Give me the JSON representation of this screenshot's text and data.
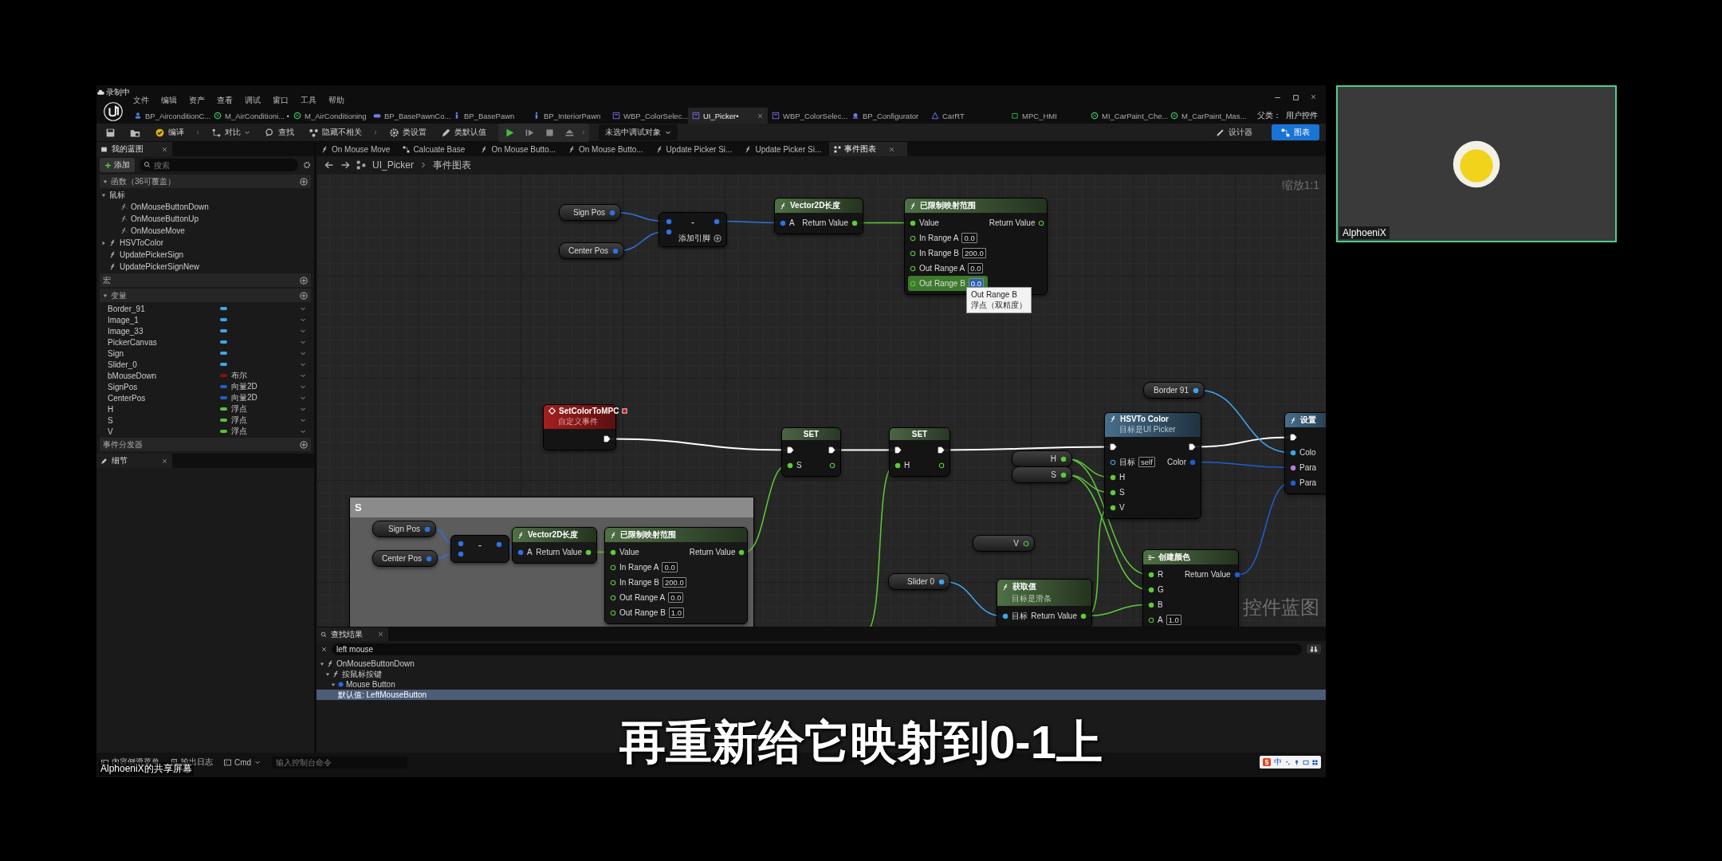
{
  "recording_indicator": "录制中",
  "menu": [
    "文件",
    "编辑",
    "资产",
    "查看",
    "调试",
    "窗口",
    "工具",
    "帮助"
  ],
  "document_tabs": [
    {
      "label": "BP_AirconditionC...",
      "kind": "blueprint",
      "selected": false
    },
    {
      "label": "M_AirConditioni... •",
      "kind": "material",
      "selected": false
    },
    {
      "label": "M_AirConditioning",
      "kind": "material",
      "selected": false
    },
    {
      "label": "BP_BasePawnCo...",
      "kind": "pawn",
      "selected": false
    },
    {
      "label": "BP_BasePawn",
      "kind": "actor",
      "selected": false
    },
    {
      "label": "BP_InteriorPawn",
      "kind": "actor",
      "selected": false
    },
    {
      "label": "WBP_ColorSelec...",
      "kind": "widget",
      "selected": false
    },
    {
      "label": "UI_Picker•",
      "kind": "widget",
      "selected": true
    },
    {
      "label": "WBP_ColorSelec...",
      "kind": "widget",
      "selected": false
    },
    {
      "label": "BP_Configurator",
      "kind": "component",
      "selected": false
    },
    {
      "label": "CarRT",
      "kind": "render_target",
      "selected": false
    },
    {
      "label": "MPC_HMI",
      "kind": "collection",
      "selected": false
    },
    {
      "label": "MI_CarPaint_Che...",
      "kind": "material",
      "selected": false
    },
    {
      "label": "M_CarPaint_Mas...",
      "kind": "material",
      "selected": false
    }
  ],
  "parent_class": {
    "label": "父类：",
    "value": "用户控件"
  },
  "toolbar": [
    {
      "kind": "save"
    },
    {
      "kind": "browse"
    },
    {
      "kind": "compile",
      "label": "编译",
      "more": true
    },
    {
      "kind": "diff",
      "label": "对比",
      "caret": true
    },
    {
      "kind": "find",
      "label": "查找"
    },
    {
      "kind": "hide",
      "label": "隐藏不相关",
      "more": true
    },
    {
      "kind": "settings",
      "label": "类设置"
    },
    {
      "kind": "defaults",
      "label": "类默认值"
    },
    {
      "kind": "play"
    },
    {
      "kind": "step"
    },
    {
      "kind": "stop"
    },
    {
      "kind": "eject",
      "more": true
    }
  ],
  "debug_dropdown": {
    "value": "未选中调试对象"
  },
  "modes": [
    {
      "label": "设计器",
      "selected": false
    },
    {
      "label": "图表",
      "selected": true
    }
  ],
  "my_blueprint": {
    "tab": "我的蓝图",
    "add_button": "添加",
    "search": {
      "placeholder": "搜索"
    },
    "functions": {
      "header": "函数（36可覆盖）",
      "expanded": true,
      "items": [
        {
          "kind": "category",
          "label": "鼠标",
          "expanded": true,
          "children": [
            {
              "kind": "override",
              "label": "OnMouseButtonDown"
            },
            {
              "kind": "override",
              "label": "OnMouseButtonUp"
            },
            {
              "kind": "override",
              "label": "OnMouseMove"
            }
          ]
        },
        {
          "kind": "function",
          "label": "HSVToColor",
          "expanded": false
        },
        {
          "kind": "function",
          "label": "UpdatePickerSign"
        },
        {
          "kind": "function",
          "label": "UpdatePickerSignNew"
        }
      ]
    },
    "macros": {
      "header": "宏"
    },
    "variables": {
      "header": "变量",
      "expanded": true,
      "items": [
        {
          "name": "Border_91",
          "color": "#3fa7e6"
        },
        {
          "name": "Image_1",
          "color": "#3fa7e6"
        },
        {
          "name": "Image_33",
          "color": "#3fa7e6"
        },
        {
          "name": "PickerCanvas",
          "color": "#3fa7e6"
        },
        {
          "name": "Sign",
          "color": "#3fa7e6"
        },
        {
          "name": "Slider_0",
          "color": "#3fa7e6"
        },
        {
          "name": "bMouseDown",
          "type": "布尔",
          "color": "#8a0f12"
        },
        {
          "name": "SignPos",
          "type": "向量2D",
          "color": "#1f5fc8"
        },
        {
          "name": "CenterPos",
          "type": "向量2D",
          "color": "#1f5fc8"
        },
        {
          "name": "H",
          "type": "浮点",
          "color": "#56c23a"
        },
        {
          "name": "S",
          "type": "浮点",
          "color": "#56c23a"
        },
        {
          "name": "V",
          "type": "浮点",
          "color": "#56c23a"
        }
      ]
    },
    "event_dispatchers": {
      "header": "事件分发器"
    },
    "details_tab": "细节"
  },
  "graph_tabs": [
    {
      "kind": "function",
      "label": "On Mouse Move",
      "selected": false
    },
    {
      "kind": "macro",
      "label": "Calcuate Base",
      "selected": false
    },
    {
      "kind": "function",
      "label": "On Mouse Butto...",
      "selected": false
    },
    {
      "kind": "function",
      "label": "On Mouse Butto...",
      "selected": false
    },
    {
      "kind": "function",
      "label": "Update Picker Si...",
      "selected": false
    },
    {
      "kind": "function",
      "label": "Update Picker Si...",
      "selected": false
    },
    {
      "kind": "graph",
      "label": "事件图表",
      "selected": true
    }
  ],
  "breadcrumb": [
    "UI_Picker",
    "事件图表"
  ],
  "graph": {
    "zoom_label": "缩放1:1",
    "type_label": "控件蓝图",
    "nodes": [
      {
        "kind": "getter",
        "label": "Sign Pos",
        "pin": {
          "kind": "vector2d",
          "connected": true
        }
      },
      {
        "kind": "getter",
        "label": "Center Pos",
        "pin": {
          "kind": "vector2d",
          "connected": true
        }
      },
      {
        "kind": "math",
        "symbol": "-",
        "add_pin": "添加引脚",
        "inputs": [
          {
            "kind": "vector2d",
            "connected": true
          },
          {
            "kind": "vector2d",
            "connected": true
          }
        ],
        "outputs": [
          {
            "kind": "vector2d",
            "connected": true
          }
        ]
      },
      {
        "kind": "pure_function",
        "title": "Vector2D长度",
        "inputs": [
          {
            "label": "A",
            "kind": "vector2d",
            "connected": true
          }
        ],
        "outputs": [
          {
            "label": "Return Value",
            "kind": "float",
            "connected": true
          }
        ]
      },
      {
        "kind": "pure_function",
        "title": "已限制映射范围",
        "inputs": [
          {
            "label": "Value",
            "kind": "float",
            "connected": true,
            "highlighted": false
          },
          {
            "label": "In Range A",
            "kind": "float",
            "connected": false,
            "value": "0.0",
            "highlighted": false
          },
          {
            "label": "In Range B",
            "kind": "float",
            "connected": false,
            "value": "200.0",
            "highlighted": false
          },
          {
            "label": "Out Range A",
            "kind": "float",
            "connected": false,
            "value": "0.0",
            "highlighted": false
          },
          {
            "label": "Out Range B",
            "kind": "float",
            "connected": false,
            "value": "0.0",
            "highlighted": true
          }
        ],
        "outputs": [
          {
            "label": "Return Value",
            "kind": "float",
            "connected": false
          }
        ]
      },
      {
        "kind": "getter",
        "label": "Border 91",
        "pin": {
          "kind": "object",
          "connected": true
        }
      },
      {
        "kind": "event",
        "title": "SetColorToMPC",
        "subtitle": "自定义事件",
        "exec_out": true
      },
      {
        "kind": "set",
        "title": "SET",
        "exec_in": true,
        "exec_out": true,
        "inputs": [
          {
            "label": "S",
            "kind": "float",
            "connected": true
          }
        ],
        "outputs": [
          {
            "kind": "float",
            "connected": false
          }
        ]
      },
      {
        "kind": "set",
        "title": "SET",
        "exec_in": true,
        "exec_out": true,
        "inputs": [
          {
            "label": "H",
            "kind": "float",
            "connected": true
          }
        ],
        "outputs": [
          {
            "kind": "float",
            "connected": false
          }
        ]
      },
      {
        "kind": "getter",
        "label": "H",
        "pin": {
          "kind": "float",
          "connected": true
        }
      },
      {
        "kind": "getter",
        "label": "S",
        "pin": {
          "kind": "float",
          "connected": true
        }
      },
      {
        "kind": "function",
        "title": "HSVTo Color",
        "subtitle": "目标是UI Picker",
        "exec_in": true,
        "exec_out": true,
        "inputs": [
          {
            "label": "目标",
            "kind": "object",
            "connected": false,
            "value": "self"
          },
          {
            "label": "H",
            "kind": "float",
            "connected": true
          },
          {
            "label": "S",
            "kind": "float",
            "connected": true
          },
          {
            "label": "V",
            "kind": "float",
            "connected": true
          }
        ],
        "outputs": [
          {
            "label": "Color",
            "kind": "struct",
            "connected": true
          }
        ]
      },
      {
        "kind": "function",
        "title": "设置",
        "exec_in": true,
        "inputs": [
          {
            "label": "Colo",
            "kind": "object",
            "connected": true
          },
          {
            "label": "Para",
            "kind": "name",
            "connected": true
          },
          {
            "label": "Para",
            "kind": "struct",
            "connected": true
          }
        ]
      },
      {
        "kind": "comment",
        "title": "S"
      },
      {
        "kind": "getter",
        "label": "Sign Pos",
        "pin": {
          "kind": "vector2d",
          "connected": true
        }
      },
      {
        "kind": "getter",
        "label": "Center Pos",
        "pin": {
          "kind": "vector2d",
          "connected": true
        }
      },
      {
        "kind": "math",
        "symbol": "-",
        "inputs": [
          {
            "kind": "vector2d",
            "connected": true
          },
          {
            "kind": "vector2d",
            "connected": true
          }
        ],
        "outputs": [
          {
            "kind": "vector2d",
            "connected": true
          }
        ]
      },
      {
        "kind": "pure_function",
        "title": "Vector2D长度",
        "inputs": [
          {
            "label": "A",
            "kind": "vector2d",
            "connected": true
          }
        ],
        "outputs": [
          {
            "label": "Return Value",
            "kind": "float",
            "connected": true
          }
        ]
      },
      {
        "kind": "pure_function",
        "title": "已限制映射范围",
        "inputs": [
          {
            "label": "Value",
            "kind": "float",
            "connected": true
          },
          {
            "label": "In Range A",
            "kind": "float",
            "connected": false,
            "value": "0.0"
          },
          {
            "label": "In Range B",
            "kind": "float",
            "connected": false,
            "value": "200.0"
          },
          {
            "label": "Out Range A",
            "kind": "float",
            "connected": false,
            "value": "0.0"
          },
          {
            "label": "Out Range B",
            "kind": "float",
            "connected": false,
            "value": "1.0"
          }
        ],
        "outputs": [
          {
            "label": "Return Value",
            "kind": "float",
            "connected": true
          }
        ]
      },
      {
        "kind": "getter",
        "label": "V",
        "pin": {
          "kind": "float",
          "connected": false
        }
      },
      {
        "kind": "getter",
        "label": "Slider 0",
        "pin": {
          "kind": "object",
          "connected": true
        }
      },
      {
        "kind": "pure_function",
        "title": "获取值",
        "subtitle": "目标是滑条",
        "inputs": [
          {
            "label": "目标",
            "kind": "object",
            "connected": true
          }
        ],
        "outputs": [
          {
            "label": "Return Value",
            "kind": "float",
            "connected": true
          }
        ]
      },
      {
        "kind": "make",
        "title": "创建颜色",
        "inputs": [
          {
            "label": "R",
            "kind": "float",
            "connected": true
          },
          {
            "label": "G",
            "kind": "float",
            "connected": true
          },
          {
            "label": "B",
            "kind": "float",
            "connected": true
          },
          {
            "label": "A",
            "kind": "float",
            "connected": false,
            "value": "1.0"
          }
        ],
        "outputs": [
          {
            "label": "Return Value",
            "kind": "struct",
            "connected": true
          }
        ]
      }
    ],
    "tooltip": {
      "title": "Out Range B",
      "text": "浮点（双精度）"
    }
  },
  "find_results": {
    "tab": "查找结果",
    "search": {
      "value": "left mouse"
    },
    "results": [
      {
        "kind": "function",
        "label": "OnMouseButtonDown",
        "expanded": true,
        "selected": false,
        "children": [
          {
            "kind": "function",
            "label": "按鼠标按键",
            "expanded": true,
            "selected": false,
            "children": [
              {
                "kind": "pin",
                "label": "Mouse Button",
                "expanded": true,
                "selected": false,
                "children": [
                  {
                    "kind": "value",
                    "label": "默认值: LeftMouseButton",
                    "selected": true
                  }
                ]
              }
            ]
          }
        ]
      }
    ]
  },
  "status_bar": {
    "content_drawer": "内容侧滑菜单",
    "output_log": "输出日志",
    "console_mode": "Cmd",
    "console": {
      "placeholder": "输入控制台命令"
    }
  },
  "ime": {
    "mode": "中"
  },
  "share_label": "AlphoeniX的共享屏幕",
  "subtitle": "再重新给它映射到0-1上",
  "video_tile": {
    "name": "AlphoeniX",
    "speaking": true
  }
}
